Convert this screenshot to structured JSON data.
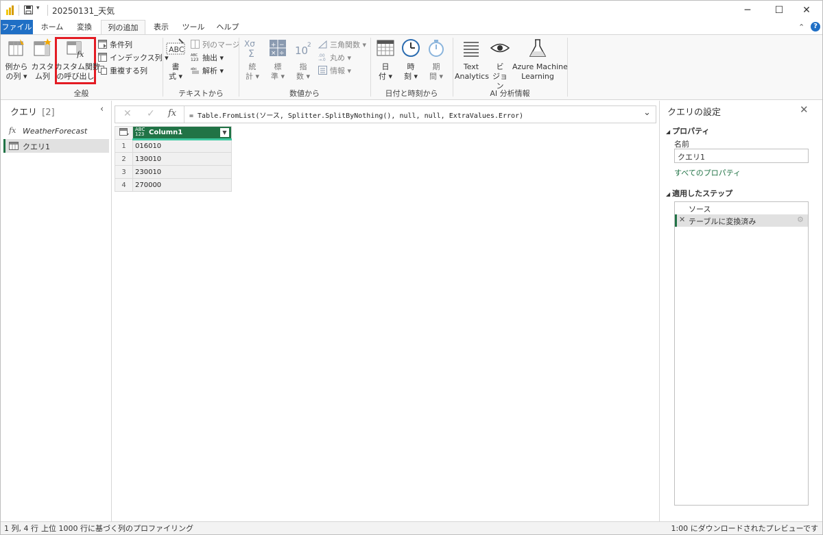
{
  "window": {
    "title": "20250131_天気",
    "minimize": "─",
    "maximize": "☐",
    "close": "✕"
  },
  "tabs": [
    {
      "label": "ファイル"
    },
    {
      "label": "ホーム"
    },
    {
      "label": "変換"
    },
    {
      "label": "列の追加"
    },
    {
      "label": "表示"
    },
    {
      "label": "ツール"
    },
    {
      "label": "ヘルプ"
    }
  ],
  "help_label": "?",
  "ribbon": {
    "general": {
      "label": "全般",
      "example_col": [
        "例から",
        "の列 ▾"
      ],
      "custom_col": [
        "カスタ",
        "ム列"
      ],
      "invoke_fn": [
        "カスタム関数",
        "の呼び出し"
      ],
      "conditional": "条件列",
      "index": "インデックス列 ▾",
      "duplicate": "重複する列"
    },
    "text": {
      "label": "テキストから",
      "format": [
        "書",
        "式 ▾"
      ],
      "merge": "列のマージ",
      "extract": "抽出 ▾",
      "parse": "解析 ▾"
    },
    "number": {
      "label": "数値から",
      "stats": [
        "統",
        "計 ▾"
      ],
      "standard": [
        "標",
        "準 ▾"
      ],
      "scientific": [
        "指",
        "数 ▾"
      ],
      "trig": "三角関数 ▾",
      "rounding": "丸め ▾",
      "info": "情報 ▾"
    },
    "datetime": {
      "label": "日付と時刻から",
      "date": [
        "日",
        "付 ▾"
      ],
      "time": [
        "時",
        "刻 ▾"
      ],
      "duration": [
        "期",
        "間 ▾"
      ]
    },
    "ai": {
      "label": "AI 分析情報",
      "text_analytics": [
        "Text",
        "Analytics"
      ],
      "vision": [
        "ビ",
        "ジョン"
      ],
      "azure_ml": [
        "Azure Machine",
        "Learning"
      ]
    }
  },
  "queries": {
    "title": "クエリ",
    "count": "[2]",
    "items": [
      {
        "label": "WeatherForecast",
        "type": "function"
      },
      {
        "label": "クエリ1",
        "type": "table"
      }
    ]
  },
  "formula": {
    "text": "= Table.FromList(ソース, Splitter.SplitByNothing(), null, null, ExtraValues.Error)"
  },
  "grid": {
    "column": "Column1",
    "type_badge": [
      "ABC",
      "123"
    ],
    "rows": [
      {
        "n": "1",
        "v": "016010"
      },
      {
        "n": "2",
        "v": "130010"
      },
      {
        "n": "3",
        "v": "230010"
      },
      {
        "n": "4",
        "v": "270000"
      }
    ]
  },
  "settings": {
    "title": "クエリの設定",
    "properties_header": "プロパティ",
    "name_label": "名前",
    "name_value": "クエリ1",
    "all_props": "すべてのプロパティ",
    "steps_header": "適用したステップ",
    "steps": [
      "ソース",
      "テーブルに変換済み"
    ]
  },
  "status": {
    "left1": "1 列, 4 行",
    "left2": "上位 1000 行に基づく列のプロファイリング",
    "right": "1:00 にダウンロードされたプレビューです"
  },
  "colors": {
    "accent": "#1f6fc5",
    "teal": "#217346",
    "highlight": "#e31b23"
  }
}
